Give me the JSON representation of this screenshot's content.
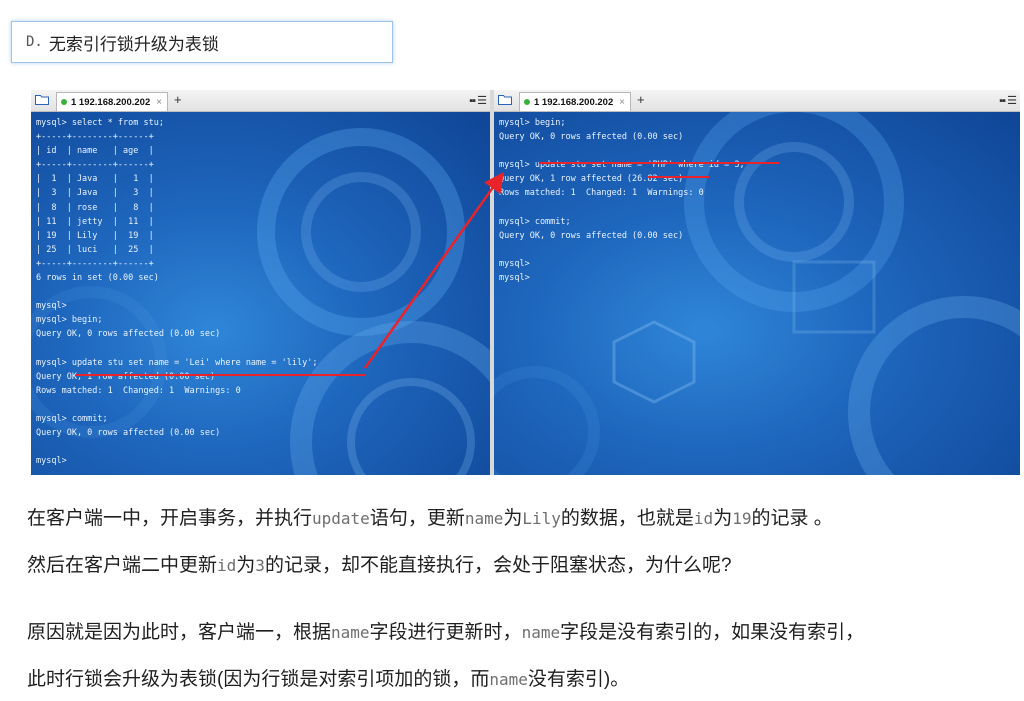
{
  "heading": {
    "prefix": "D.",
    "text": "无索引行锁升级为表锁"
  },
  "left_tab": {
    "title": "1 192.168.200.202",
    "close": "×",
    "plus": "+"
  },
  "right_tab": {
    "title": "1 192.168.200.202",
    "close": "×",
    "plus": "+"
  },
  "left_terminal": [
    "mysql> select * from stu;",
    "+-----+--------+------+",
    "| id  | name   | age  |",
    "+-----+--------+------+",
    "|  1  | Java   |   1  |",
    "|  3  | Java   |   3  |",
    "|  8  | rose   |   8  |",
    "| 11  | jetty  |  11  |",
    "| 19  | Lily   |  19  |",
    "| 25  | luci   |  25  |",
    "+-----+--------+------+",
    "6 rows in set (0.00 sec)",
    "",
    "mysql>",
    "mysql> begin;",
    "Query OK, 0 rows affected (0.00 sec)",
    "",
    "mysql> update stu set name = 'Lei' where name = 'lily';",
    "Query OK, 1 row affected (0.00 sec)",
    "Rows matched: 1  Changed: 1  Warnings: 0",
    "",
    "mysql> commit;",
    "Query OK, 0 rows affected (0.00 sec)",
    "",
    "mysql>"
  ],
  "right_terminal": [
    "mysql> begin;",
    "Query OK, 0 rows affected (0.00 sec)",
    "",
    "mysql> update stu set name = 'PHP' where id = 3;",
    "Query OK, 1 row affected (26.82 sec)",
    "Rows matched: 1  Changed: 1  Warnings: 0",
    "",
    "mysql> commit;",
    "Query OK, 0 rows affected (0.00 sec)",
    "",
    "mysql>",
    "mysql> "
  ],
  "paragraphs": {
    "p1": [
      "在客户端一中，开启事务，并执行",
      "update",
      "语句，更新",
      "name",
      "为",
      "Lily",
      "的数据，也就是",
      "id",
      "为",
      "19",
      "的记录  。"
    ],
    "p2": [
      "然后在客户端二中更新",
      "id",
      "为",
      "3",
      "的记录，却不能直接执行，会处于阻塞状态，为什么呢?"
    ],
    "p3": [
      "原因就是因为此时，客户端一，根据",
      "name",
      "字段进行更新时，",
      "name",
      "字段是没有索引的，如果没有索引，"
    ],
    "p4": [
      "此时行锁会升级为表锁(因为行锁是对索引项加的锁，而",
      "name",
      "没有索引)。"
    ]
  },
  "colors": {
    "annotation": "#e8232a",
    "terminal_bg": "#1e66bd",
    "heading_border": "#9ec3ee"
  }
}
